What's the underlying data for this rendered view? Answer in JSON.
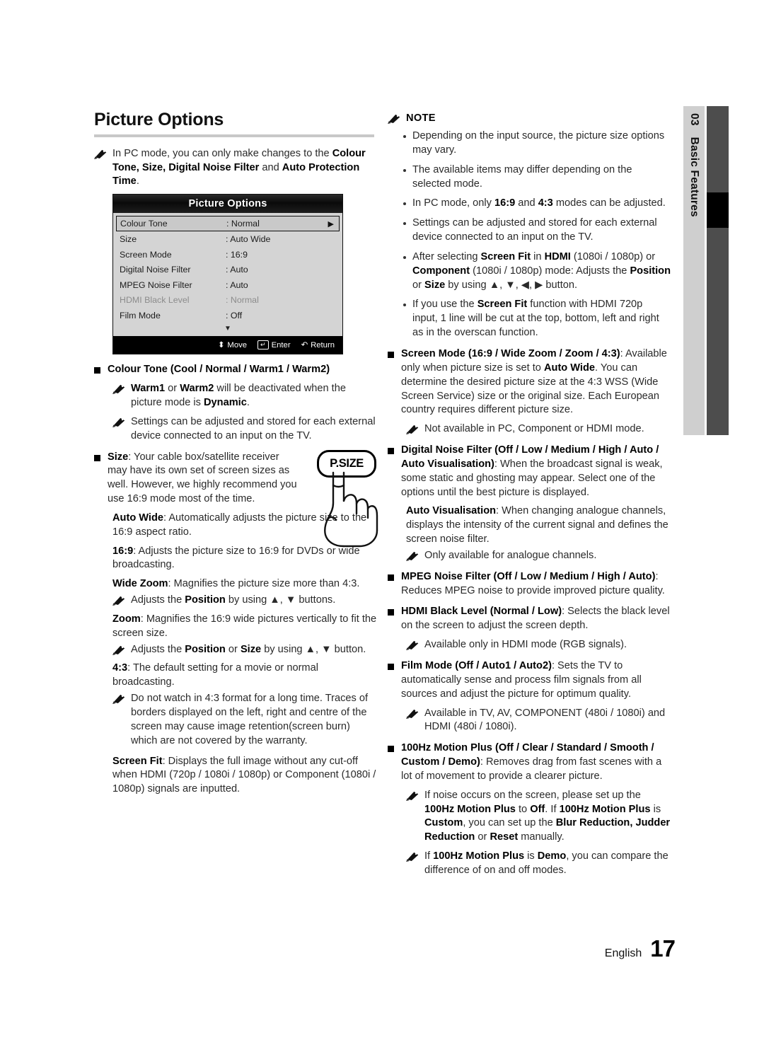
{
  "page": {
    "section_title": "Picture Options",
    "footer_language": "English",
    "footer_page_number": "17",
    "chapter_number": "03",
    "chapter_name": "Basic Features"
  },
  "icons": {
    "pencil": "pencil-note-icon",
    "square_bullet": "square-bullet-icon",
    "dot_bullet": "dot-bullet-icon",
    "move": "up-down-arrow-icon",
    "enter": "enter-key-icon",
    "return": "return-arrow-icon",
    "right_arrow": "right-arrow-icon",
    "scroll_down": "scroll-down-arrow-icon"
  },
  "left_column": {
    "intro_note": {
      "plain_1": "In PC mode, you can only make changes to the ",
      "bold_1": "Colour Tone, Size, Digital Noise Filter",
      "plain_2": " and ",
      "bold_2": "Auto Protection Time",
      "plain_3": "."
    },
    "osd": {
      "title": "Picture Options",
      "rows": [
        {
          "label": "Colour Tone",
          "value": ": Normal",
          "selected": true,
          "dim": false,
          "arrow": "▶"
        },
        {
          "label": "Size",
          "value": ": Auto Wide",
          "selected": false,
          "dim": false,
          "arrow": ""
        },
        {
          "label": "Screen Mode",
          "value": ": 16:9",
          "selected": false,
          "dim": false,
          "arrow": ""
        },
        {
          "label": "Digital Noise Filter",
          "value": ": Auto",
          "selected": false,
          "dim": false,
          "arrow": ""
        },
        {
          "label": "MPEG Noise Filter",
          "value": ": Auto",
          "selected": false,
          "dim": false,
          "arrow": ""
        },
        {
          "label": "HDMI Black Level",
          "value": ": Normal",
          "selected": false,
          "dim": true,
          "arrow": ""
        },
        {
          "label": "Film Mode",
          "value": ": Off",
          "selected": false,
          "dim": false,
          "arrow": ""
        }
      ],
      "scroll_glyph": "▼",
      "footer": {
        "move_glyph": "⬍",
        "move_label": "Move",
        "enter_glyph": "↵",
        "enter_label": "Enter",
        "return_glyph": "↶",
        "return_label": "Return"
      }
    },
    "colour_tone_heading": "Colour Tone (Cool / Normal / Warm1 / Warm2)",
    "colour_tone_note_1": {
      "bold_1": "Warm1",
      "plain_1": " or ",
      "bold_2": "Warm2",
      "plain_2": " will be deactivated when the picture mode is ",
      "bold_3": "Dynamic",
      "plain_3": "."
    },
    "colour_tone_note_2": "Settings can be adjusted and stored for each external device connected to an input on the TV.",
    "size_heading_bold": "Size",
    "size_heading_rest": ": Your cable box/satellite receiver may have its own set of screen sizes as well. However, we highly recommend you use 16:9 mode most of the time.",
    "psize_button_label": "P.SIZE",
    "auto_wide_bold": "Auto Wide",
    "auto_wide_rest": ": Automatically adjusts the picture size to the 16:9 aspect ratio.",
    "ratio169_bold": "16:9",
    "ratio169_rest": ": Adjusts the picture size to 16:9 for DVDs or wide broadcasting.",
    "wide_zoom_bold": "Wide Zoom",
    "wide_zoom_rest": ": Magnifies the picture size more than 4:3.",
    "wide_zoom_note": {
      "plain_1": "Adjusts the ",
      "bold_1": "Position",
      "plain_2": " by using ▲, ▼ buttons."
    },
    "zoom_bold": "Zoom",
    "zoom_rest": ": Magnifies the 16:9 wide pictures vertically to fit the screen size.",
    "zoom_note": {
      "plain_1": "Adjusts the ",
      "bold_1": "Position",
      "plain_2": " or ",
      "bold_2": "Size",
      "plain_3": " by using ▲, ▼ button."
    },
    "ratio43_bold": "4:3",
    "ratio43_rest": ": The default setting for a movie or normal broadcasting.",
    "ratio43_note": "Do not watch in 4:3 format for a long time. Traces of borders displayed on the left, right and centre of the screen may cause image retention(screen burn) which are not covered by the warranty.",
    "screen_fit_bold": "Screen Fit",
    "screen_fit_rest": ": Displays the full image without any cut-off when HDMI (720p / 1080i / 1080p) or Component (1080i / 1080p) signals are inputted."
  },
  "right_column": {
    "note_label": "NOTE",
    "note_items": [
      {
        "parts": [
          {
            "text": "Depending on the input source, the picture size options may vary.",
            "bold": false
          }
        ]
      },
      {
        "parts": [
          {
            "text": "The available items may differ depending on the selected mode.",
            "bold": false
          }
        ]
      },
      {
        "parts": [
          {
            "text": "In PC mode, only ",
            "bold": false
          },
          {
            "text": "16:9",
            "bold": true
          },
          {
            "text": " and ",
            "bold": false
          },
          {
            "text": "4:3",
            "bold": true
          },
          {
            "text": " modes can be adjusted.",
            "bold": false
          }
        ]
      },
      {
        "parts": [
          {
            "text": "Settings can be adjusted and stored for each external device connected to an input on the TV.",
            "bold": false
          }
        ]
      },
      {
        "parts": [
          {
            "text": "After selecting ",
            "bold": false
          },
          {
            "text": "Screen Fit",
            "bold": true
          },
          {
            "text": " in ",
            "bold": false
          },
          {
            "text": "HDMI",
            "bold": true
          },
          {
            "text": " (1080i / 1080p) or ",
            "bold": false
          },
          {
            "text": "Component",
            "bold": true
          },
          {
            "text": " (1080i / 1080p) mode: Adjusts the ",
            "bold": false
          },
          {
            "text": "Position",
            "bold": true
          },
          {
            "text": " or ",
            "bold": false
          },
          {
            "text": "Size",
            "bold": true
          },
          {
            "text": " by using ▲, ▼, ◀, ▶ button.",
            "bold": false
          }
        ]
      },
      {
        "parts": [
          {
            "text": "If you use the ",
            "bold": false
          },
          {
            "text": "Screen Fit",
            "bold": true
          },
          {
            "text": " function with HDMI 720p input, 1 line will be cut at the top, bottom, left and right as in the overscan function.",
            "bold": false
          }
        ]
      }
    ],
    "screen_mode": {
      "heading_bold": "Screen Mode (16:9 / Wide Zoom / Zoom / 4:3)",
      "body": ": Available only when picture size is set to ",
      "body_bold": "Auto Wide",
      "body_rest": ". You can determine the desired picture size at the 4:3 WSS (Wide Screen Service) size or the original size. Each European country requires different picture size.",
      "note": "Not available in PC, Component or HDMI mode."
    },
    "digital_noise_filter": {
      "heading_bold": "Digital Noise Filter (Off / Low / Medium / High / Auto / Auto Visualisation)",
      "body": ": When the broadcast signal is weak, some static and ghosting may appear. Select one of the options until the best picture is displayed.",
      "auto_vis_bold": "Auto Visualisation",
      "auto_vis_rest": ": When changing analogue channels, displays the intensity of the current signal and defines the screen noise filter.",
      "note": "Only available for analogue channels."
    },
    "mpeg_noise_filter": {
      "heading_bold": "MPEG Noise Filter (Off / Low / Medium / High / Auto)",
      "body": ": Reduces MPEG noise to provide improved picture quality."
    },
    "hdmi_black_level": {
      "heading_bold": "HDMI Black Level (Normal / Low)",
      "body": ": Selects the black level on the screen to adjust the screen depth.",
      "note": "Available only in HDMI mode (RGB signals)."
    },
    "film_mode": {
      "heading_bold": "Film Mode (Off / Auto1 / Auto2)",
      "body": ": Sets the TV to automatically sense and process film signals from all sources and adjust the picture for optimum quality.",
      "note": "Available in TV, AV, COMPONENT (480i / 1080i) and HDMI (480i / 1080i)."
    },
    "motion_plus": {
      "heading_bold": "100Hz Motion Plus (Off / Clear / Standard / Smooth / Custom / Demo)",
      "body": ": Removes drag from fast scenes with a lot of movement to provide a clearer picture.",
      "note_1_parts": [
        {
          "text": "If noise occurs on the screen, please set up the ",
          "bold": false
        },
        {
          "text": "100Hz Motion Plus",
          "bold": true
        },
        {
          "text": " to ",
          "bold": false
        },
        {
          "text": "Off",
          "bold": true
        },
        {
          "text": ". If ",
          "bold": false
        },
        {
          "text": "100Hz Motion Plus",
          "bold": true
        },
        {
          "text": " is ",
          "bold": false
        },
        {
          "text": "Custom",
          "bold": true
        },
        {
          "text": ", you can set up the ",
          "bold": false
        },
        {
          "text": "Blur Reduction, Judder Reduction",
          "bold": true
        },
        {
          "text": " or ",
          "bold": false
        },
        {
          "text": "Reset",
          "bold": true
        },
        {
          "text": " manually.",
          "bold": false
        }
      ],
      "note_2_parts": [
        {
          "text": "If ",
          "bold": false
        },
        {
          "text": "100Hz Motion Plus",
          "bold": true
        },
        {
          "text": " is ",
          "bold": false
        },
        {
          "text": "Demo",
          "bold": true
        },
        {
          "text": ", you can compare the difference of on and off modes.",
          "bold": false
        }
      ]
    }
  }
}
